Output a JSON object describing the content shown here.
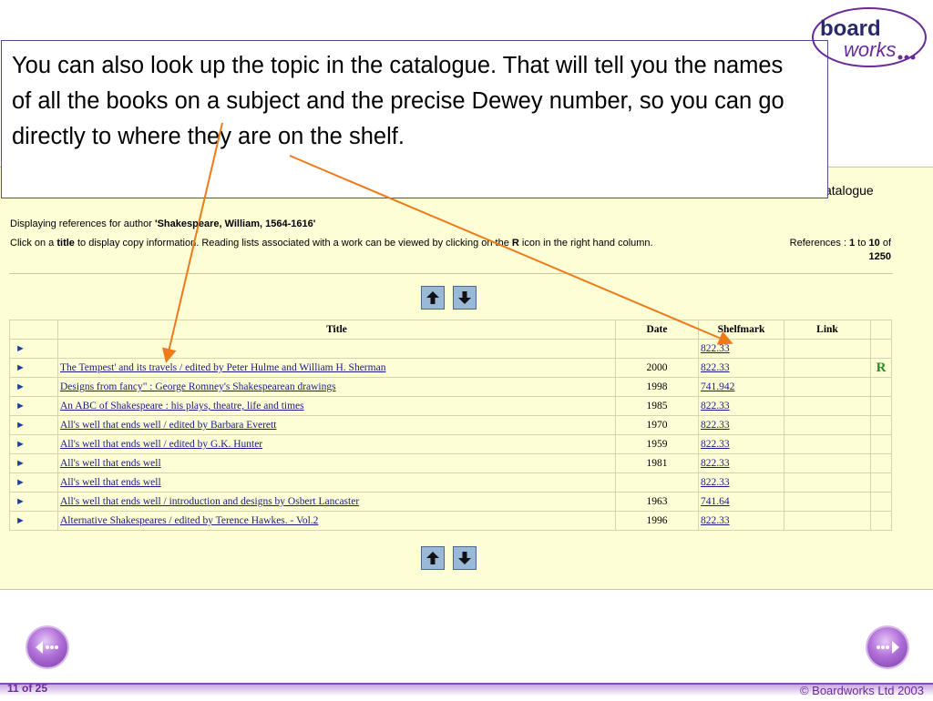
{
  "callout": {
    "text": "You can also look up the topic in the catalogue. That will tell you the names of all the books on a subject and the precise Dewey number, so you can go directly to where they are on the shelf."
  },
  "logo": {
    "line1": "board",
    "line2": "works"
  },
  "catalogue": {
    "heading": "atalogue",
    "author_prefix": "Displaying references for author ",
    "author": "'Shakespeare, William, 1564-1616'",
    "instruction_pre": "Click on a ",
    "instruction_title": "title",
    "instruction_mid": " to display copy information. Reading lists associated with a work can be viewed by clicking on the ",
    "instruction_r": "R",
    "instruction_post": " icon in the right hand column.",
    "refs_label": "References : ",
    "refs_from": "1",
    "refs_to_word": " to ",
    "refs_to": "10",
    "refs_of": " of",
    "refs_total": "1250",
    "columns": {
      "title": "Title",
      "date": "Date",
      "shelfmark": "Shelfmark",
      "link": "Link"
    },
    "rows": [
      {
        "title": "",
        "date": "",
        "shelfmark": "822.33",
        "r": ""
      },
      {
        "title": "The Tempest' and its travels / edited by Peter Hulme and William H. Sherman",
        "date": "2000",
        "shelfmark": "822.33",
        "r": "R"
      },
      {
        "title": "Designs from fancy\" : George Romney's Shakespearean drawings",
        "date": "1998",
        "shelfmark": "741.942",
        "r": ""
      },
      {
        "title": "An ABC of Shakespeare : his plays, theatre, life and times",
        "date": "1985",
        "shelfmark": "822.33",
        "r": ""
      },
      {
        "title": "All's well that ends well / edited by Barbara Everett",
        "date": "1970",
        "shelfmark": "822.33",
        "r": ""
      },
      {
        "title": "All's well that ends well / edited by G.K. Hunter",
        "date": "1959",
        "shelfmark": "822.33",
        "r": ""
      },
      {
        "title": "All's well that ends well",
        "date": "1981",
        "shelfmark": "822.33",
        "r": ""
      },
      {
        "title": "All's well that ends well",
        "date": "",
        "shelfmark": "822.33",
        "r": ""
      },
      {
        "title": "All's well that ends well / introduction and designs by Osbert Lancaster",
        "date": "1963",
        "shelfmark": "741.64",
        "r": ""
      },
      {
        "title": "Alternative Shakespeares / edited by Terence Hawkes. - Vol.2",
        "date": "1996",
        "shelfmark": "822.33",
        "r": ""
      }
    ]
  },
  "footer": {
    "slide_number": "11 of 25",
    "copyright": "© Boardworks Ltd 2003"
  },
  "colors": {
    "panel": "#fdfdd6",
    "accent": "#8a4ab8",
    "pointer": "#ee7a1a",
    "link": "#1b1b8a"
  }
}
